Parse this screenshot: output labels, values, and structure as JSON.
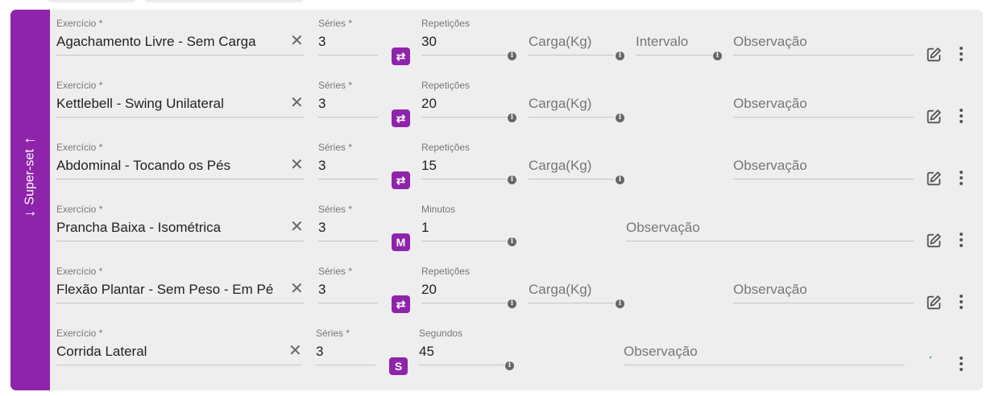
{
  "group": {
    "label": "Super-set",
    "up_arrow": "↑",
    "down_arrow": "↓"
  },
  "field_labels": {
    "exercise": "Exercício",
    "required_mark": "*",
    "series": "Séries",
    "repetitions": "Repetições",
    "minutes": "Minutos",
    "seconds": "Segundos"
  },
  "placeholders": {
    "load": "Carga(Kg)",
    "interval": "Intervalo",
    "observation": "Observação"
  },
  "icons": {
    "clear": "close-icon",
    "repeat_badge": "repeat-icon",
    "info": "info-icon",
    "edit": "edit-icon",
    "more": "more-vertical-icon"
  },
  "colors": {
    "accent": "#8e24aa",
    "card_bg": "#eeeeee"
  },
  "rows": [
    {
      "exercise": "Agachamento Livre - Sem Carga",
      "series": "3",
      "mode_badge": "⇄",
      "metric_label": "Repetições",
      "metric_value": "30"
    },
    {
      "exercise": "Kettlebell - Swing Unilateral",
      "series": "3",
      "mode_badge": "⇄",
      "metric_label": "Repetições",
      "metric_value": "20"
    },
    {
      "exercise": "Abdominal - Tocando os Pés",
      "series": "3",
      "mode_badge": "⇄",
      "metric_label": "Repetições",
      "metric_value": "15"
    },
    {
      "exercise": "Prancha Baixa - Isométrica",
      "series": "3",
      "mode_badge": "M",
      "metric_label": "Minutos",
      "metric_value": "1"
    },
    {
      "exercise": "Flexão Plantar - Sem Peso - Em Pé",
      "series": "3",
      "mode_badge": "⇄",
      "metric_label": "Repetições",
      "metric_value": "20"
    },
    {
      "exercise": "Corrida Lateral",
      "series": "3",
      "mode_badge": "S",
      "metric_label": "Segundos",
      "metric_value": "45"
    }
  ]
}
